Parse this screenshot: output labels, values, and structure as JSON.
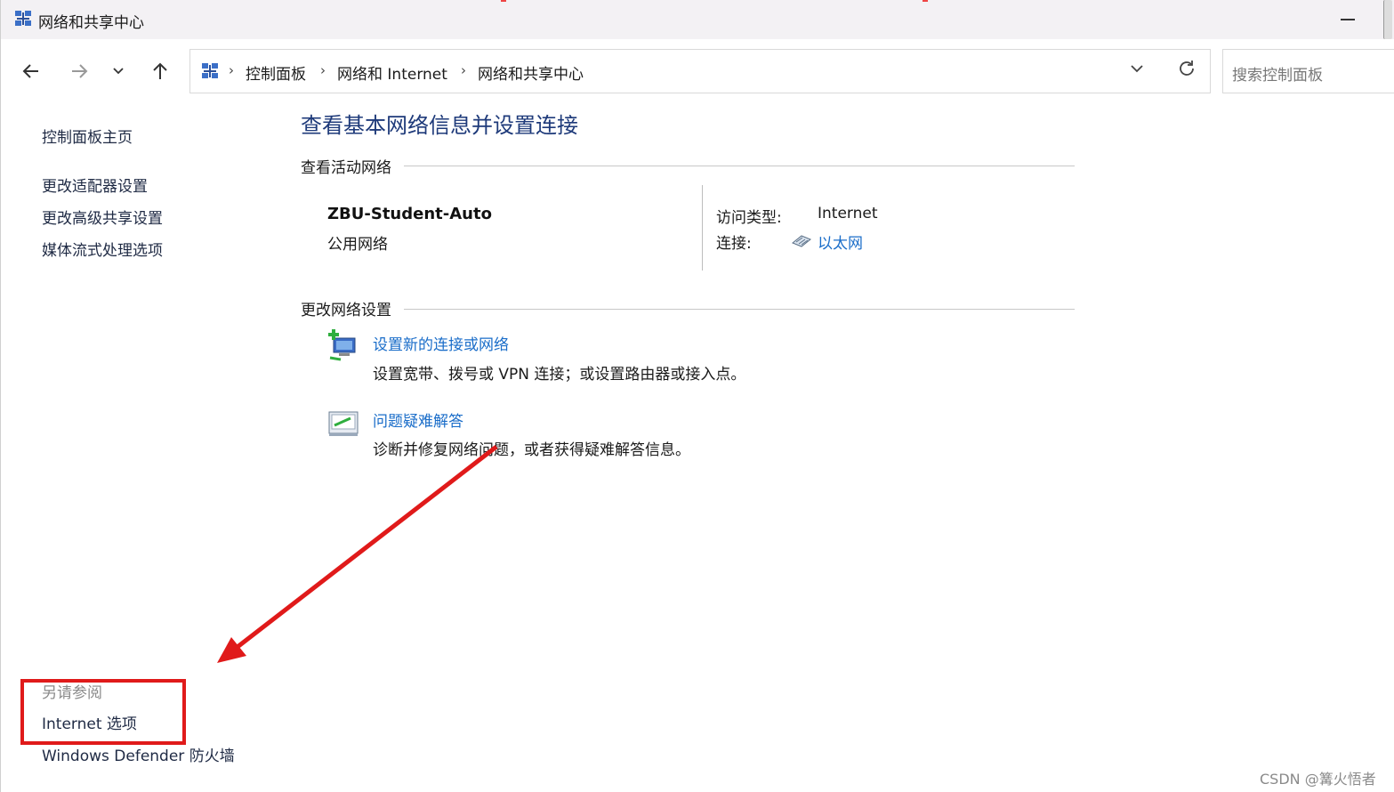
{
  "window": {
    "title": "网络和共享中心"
  },
  "navigation": {
    "back_icon": "back-arrow-icon",
    "forward_icon": "forward-arrow-icon",
    "recent_icon": "chevron-down-icon",
    "up_icon": "up-arrow-icon",
    "breadcrumbs": [
      "控制面板",
      "网络和 Internet",
      "网络和共享中心"
    ],
    "breadcrumb_separator": "›",
    "search_placeholder": "搜索控制面板"
  },
  "sidebar": {
    "links": [
      "控制面板主页",
      "更改适配器设置",
      "更改高级共享设置",
      "媒体流式处理选项"
    ],
    "see_also_heading": "另请参阅",
    "see_also_links": [
      "Internet 选项",
      "Windows Defender 防火墙"
    ]
  },
  "main": {
    "title": "查看基本网络信息并设置连接",
    "active_networks_label": "查看活动网络",
    "network": {
      "name": "ZBU-Student-Auto",
      "category": "公用网络",
      "access_type_label": "访问类型:",
      "access_type_value": "Internet",
      "connections_label": "连接:",
      "connections_value": "以太网"
    },
    "change_settings_label": "更改网络设置",
    "tasks": [
      {
        "title": "设置新的连接或网络",
        "description": "设置宽带、拨号或 VPN 连接；或设置路由器或接入点。",
        "icon": "new-connection-icon"
      },
      {
        "title": "问题疑难解答",
        "description": "诊断并修复网络问题，或者获得疑难解答信息。",
        "icon": "troubleshoot-icon"
      }
    ]
  },
  "watermark": "CSDN @篝火悟者",
  "colors": {
    "link": "#1a6dc9",
    "title": "#1e3a7a",
    "annotation": "#e01a1a",
    "titlebar": "#f3f1f4"
  }
}
